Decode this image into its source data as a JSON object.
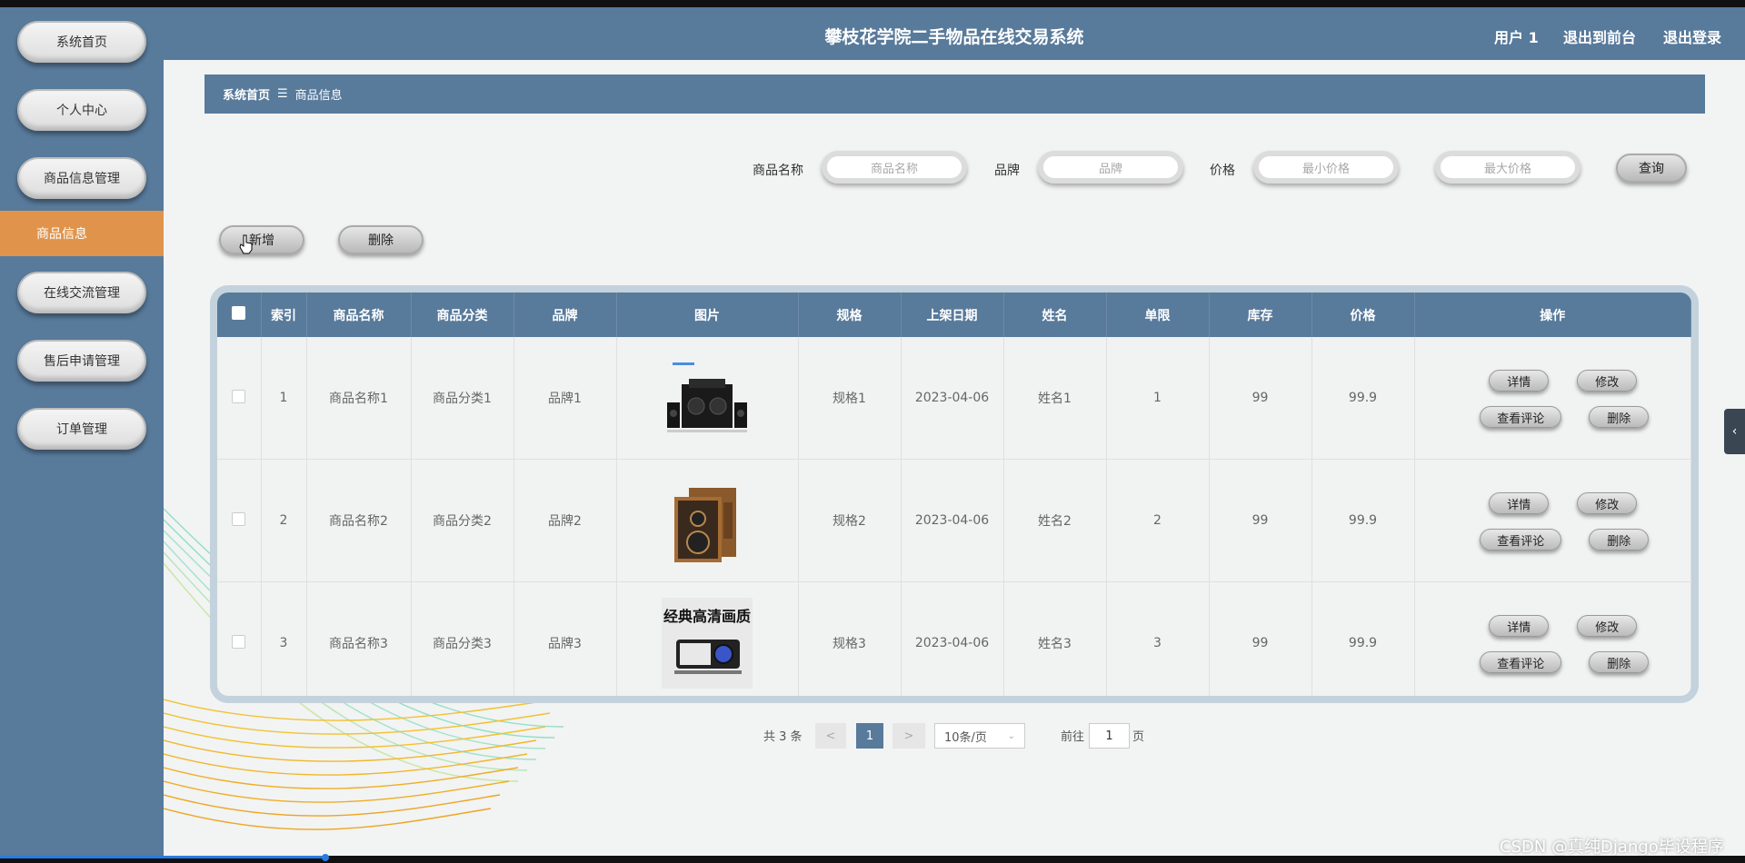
{
  "app": {
    "title": "攀枝花学院二手物品在线交易系统",
    "user_label": "用户 1",
    "front_link": "退出到前台",
    "logout_link": "退出登录"
  },
  "sidebar": {
    "items": [
      {
        "label": "系统首页"
      },
      {
        "label": "个人中心"
      },
      {
        "label": "商品信息管理"
      },
      {
        "label": "商品信息"
      },
      {
        "label": "在线交流管理"
      },
      {
        "label": "售后申请管理"
      },
      {
        "label": "订单管理"
      }
    ]
  },
  "breadcrumb": {
    "home": "系统首页",
    "separator": "☰",
    "current": "商品信息"
  },
  "search": {
    "name_label": "商品名称",
    "name_placeholder": "商品名称",
    "brand_label": "品牌",
    "brand_placeholder": "品牌",
    "price_label": "价格",
    "min_placeholder": "最小价格",
    "max_placeholder": "最大价格",
    "query_button": "查询"
  },
  "actions": {
    "add_button": "新增",
    "delete_button": "删除"
  },
  "table": {
    "columns": [
      "索引",
      "商品名称",
      "商品分类",
      "品牌",
      "图片",
      "规格",
      "上架日期",
      "姓名",
      "单限",
      "库存",
      "价格",
      "操作"
    ],
    "rows": [
      {
        "index": "1",
        "name": "商品名称1",
        "category": "商品分类1",
        "brand": "品牌1",
        "image": "speaker-set-image",
        "spec": "规格1",
        "date": "2023-04-06",
        "person": "姓名1",
        "limit": "1",
        "stock": "99",
        "price": "99.9"
      },
      {
        "index": "2",
        "name": "商品名称2",
        "category": "商品分类2",
        "brand": "品牌2",
        "image": "wooden-speaker-image",
        "spec": "规格2",
        "date": "2023-04-06",
        "person": "姓名2",
        "limit": "2",
        "stock": "99",
        "price": "99.9"
      },
      {
        "index": "3",
        "name": "商品名称3",
        "category": "商品分类3",
        "brand": "品牌3",
        "image": "projector-image",
        "spec": "规格3",
        "date": "2023-04-06",
        "person": "姓名3",
        "limit": "3",
        "stock": "99",
        "price": "99.9"
      }
    ],
    "row_actions": {
      "detail": "详情",
      "edit": "修改",
      "reviews": "查看评论",
      "delete": "删除"
    },
    "image3_text": "经典高清画质"
  },
  "pagination": {
    "total": "共 3 条",
    "prev": "<",
    "current_page": "1",
    "next": ">",
    "page_size": "10条/页",
    "goto_label": "前往",
    "goto_value": "1",
    "page_unit": "页"
  },
  "watermark": "CSDN @真纯Django毕设程序",
  "colors": {
    "header": "#587a9b",
    "active": "#e0944b",
    "page_button": "#587a9b"
  }
}
